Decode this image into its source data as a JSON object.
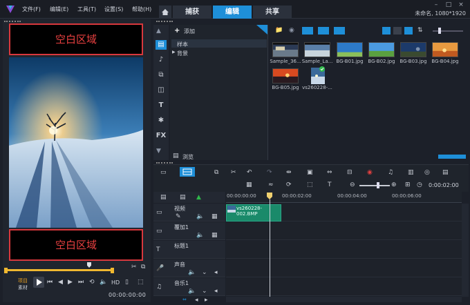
{
  "menu": [
    "文件(F)",
    "编辑(E)",
    "工具(T)",
    "设置(S)",
    "帮助(H)"
  ],
  "tabs": {
    "capture": "捕获",
    "edit": "编辑",
    "share": "共享"
  },
  "project_info": "未命名, 1080*1920",
  "preview": {
    "top_box": "空白区域",
    "bottom_box": "空白区域",
    "mode_project": "项目",
    "mode_clip": "素材",
    "hd": "HD",
    "timecode": "00:00:00:00"
  },
  "library": {
    "add_label": "添加",
    "folders": [
      "样本",
      "背景"
    ],
    "browse_label": "浏览",
    "items": [
      {
        "label": "Sample_36..."
      },
      {
        "label": "Sample_La..."
      },
      {
        "label": "BG-B01.jpg"
      },
      {
        "label": "BG-B02.jpg"
      },
      {
        "label": "BG-B03.jpg"
      },
      {
        "label": "BG-B04.jpg"
      },
      {
        "label": "BG-B05.jpg"
      },
      {
        "label": "vs260228-..."
      }
    ]
  },
  "timeline": {
    "zoom_timecode": "0:00:02:00",
    "ruler": [
      "00:00:00:00",
      "00:00:02:00",
      "00:00:04:00",
      "00:00:06:00"
    ],
    "tracks": [
      "视频",
      "覆加1",
      "标题1",
      "声音",
      "音乐1"
    ],
    "clip_label": "vs260228-002.BMP"
  }
}
